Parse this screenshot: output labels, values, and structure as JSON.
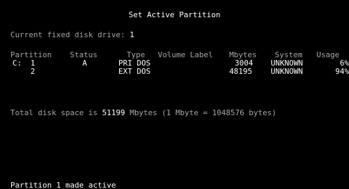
{
  "title": "Set Active Partition",
  "drive": {
    "label": "Current fixed disk drive: ",
    "number": "1"
  },
  "table": {
    "headers": {
      "partition": "Partition",
      "status": "Status",
      "type": "Type",
      "volume_label": "Volume Label",
      "mbytes": "Mbytes",
      "system": "System",
      "usage": "Usage"
    },
    "rows": [
      {
        "drive": "C:",
        "partition": "1",
        "status": "A",
        "type": "PRI DOS",
        "volume_label": "",
        "mbytes": "3004",
        "system": "UNKNOWN",
        "usage": "6%"
      },
      {
        "drive": "",
        "partition": "2",
        "status": "",
        "type": "EXT DOS",
        "volume_label": "",
        "mbytes": "48195",
        "system": "UNKNOWN",
        "usage": "94%"
      }
    ]
  },
  "total": {
    "prefix": "Total disk space is ",
    "value": "51199",
    "suffix": " Mbytes (1 Mbyte = 1048576 bytes)"
  },
  "status_message": "Partition 1 made active",
  "colors": {
    "background": "#000000",
    "text": "#a8a8a8",
    "bright": "#ffffff"
  }
}
